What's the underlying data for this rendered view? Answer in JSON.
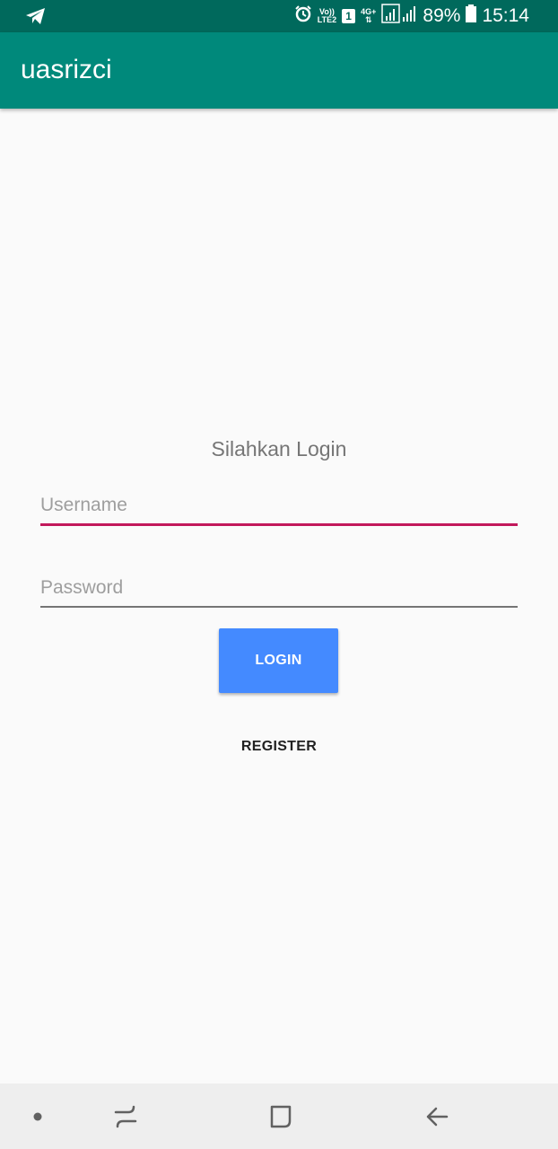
{
  "status_bar": {
    "volte_label": "Vo))",
    "lte_label": "LTE2",
    "sim_slot": "1",
    "network_type": "4G+",
    "battery_percent": "89%",
    "time": "15:14",
    "icons": [
      "telegram-icon",
      "alarm-icon",
      "signal-icon",
      "battery-icon"
    ]
  },
  "app_bar": {
    "title": "uasrizci"
  },
  "login_form": {
    "heading": "Silahkan Login",
    "username_placeholder": "Username",
    "username_value": "",
    "password_placeholder": "Password",
    "password_value": "",
    "login_label": "LOGIN",
    "register_label": "REGISTER"
  },
  "nav_bar": {
    "icons": [
      "dot-icon",
      "recent-apps-icon",
      "home-icon",
      "back-icon"
    ]
  },
  "colors": {
    "status_bar": "#00695c",
    "app_bar": "#00897b",
    "accent": "#c2185b",
    "login_button": "#448aff",
    "background": "#fafafa"
  }
}
